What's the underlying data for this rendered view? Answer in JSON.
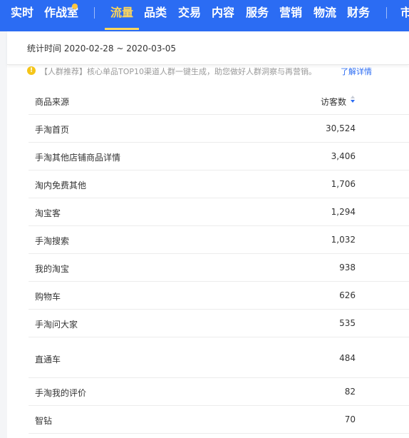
{
  "nav": {
    "items": [
      {
        "label": "实时"
      },
      {
        "label": "作战室"
      },
      {
        "label": "流量"
      },
      {
        "label": "品类"
      },
      {
        "label": "交易"
      },
      {
        "label": "内容"
      },
      {
        "label": "服务"
      },
      {
        "label": "营销"
      },
      {
        "label": "物流"
      },
      {
        "label": "财务"
      },
      {
        "label": "市"
      }
    ],
    "active_label": "流量",
    "colors": {
      "background": "#2b6cf3",
      "active": "#ffd75a",
      "badge": "#ffc53d"
    }
  },
  "date_bar": {
    "text": "统计时间 2020-02-28 ~ 2020-03-05"
  },
  "notice": {
    "icon": "warning-icon",
    "text": "【人群推荐】核心单品TOP10渠道人群一键生成，助您做好人群洞察与再营销。",
    "link": "了解详情"
  },
  "table": {
    "columns": {
      "source": "商品来源",
      "visitors": "访客数"
    },
    "sort": "descending",
    "rows": [
      {
        "source": "手淘首页",
        "visitors": "30,524"
      },
      {
        "source": "手淘其他店铺商品详情",
        "visitors": "3,406"
      },
      {
        "source": "淘内免费其他",
        "visitors": "1,706"
      },
      {
        "source": "淘宝客",
        "visitors": "1,294"
      },
      {
        "source": "手淘搜索",
        "visitors": "1,032"
      },
      {
        "source": "我的淘宝",
        "visitors": "938"
      },
      {
        "source": "购物车",
        "visitors": "626"
      },
      {
        "source": "手淘问大家",
        "visitors": "535"
      },
      {
        "source": "直通车",
        "visitors": "484"
      },
      {
        "source": "手淘我的评价",
        "visitors": "82"
      },
      {
        "source": "智钻",
        "visitors": "70"
      }
    ]
  }
}
